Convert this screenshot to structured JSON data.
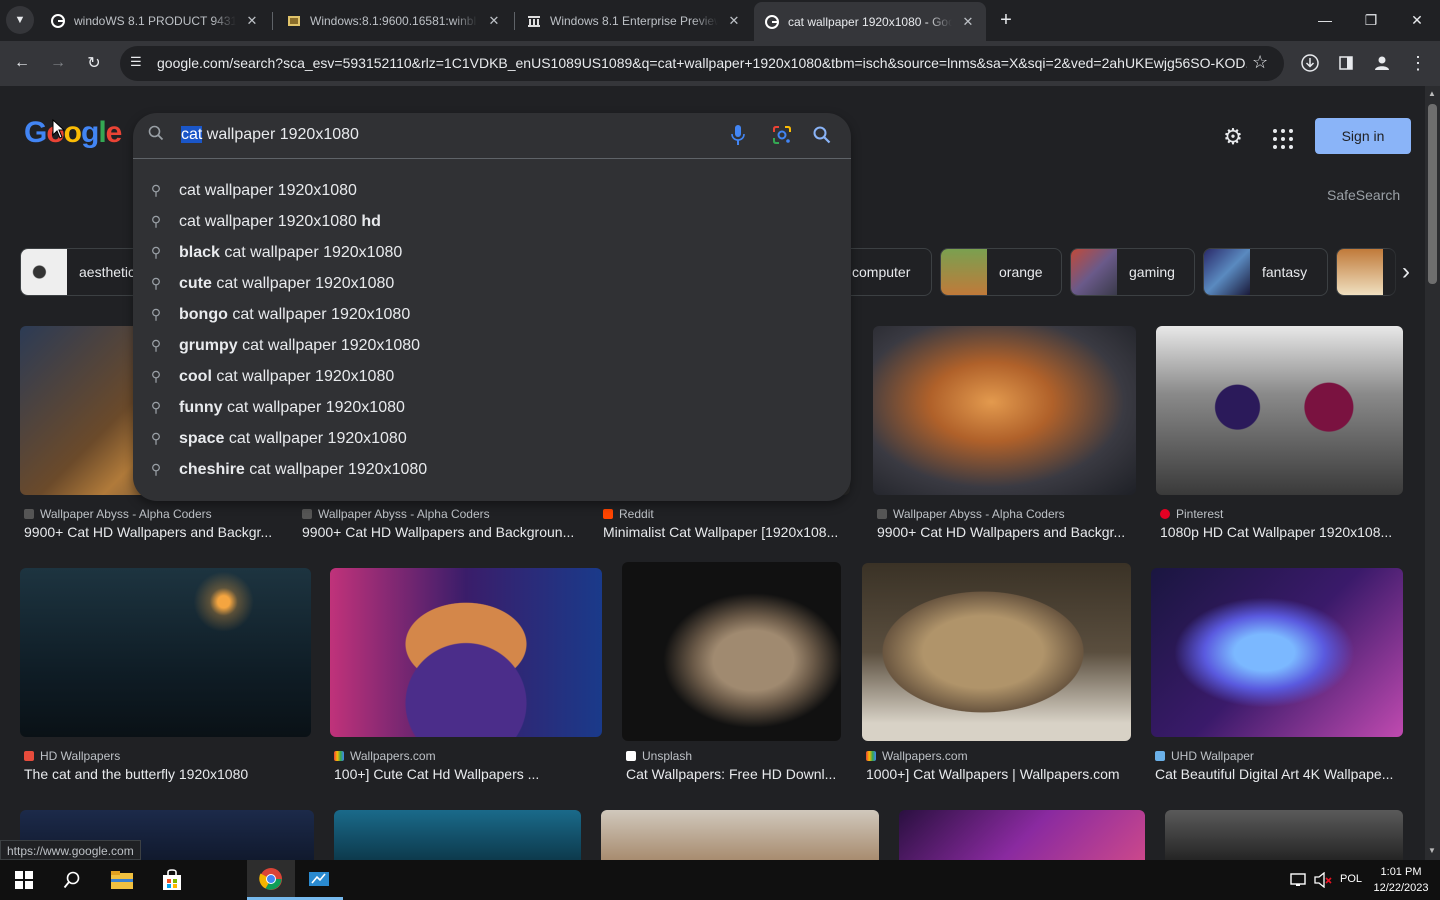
{
  "browser": {
    "tabs": [
      {
        "title": "windoWS 8.1 PRODUCT 9431 -",
        "favicon": "google-icon"
      },
      {
        "title": "Windows:8.1:9600.16581:winbl",
        "favicon": "page-icon"
      },
      {
        "title": "Windows 8.1 Enterprise Preview",
        "favicon": "archive-icon"
      },
      {
        "title": "cat wallpaper 1920x1080 - Goo",
        "favicon": "google-icon",
        "active": true
      }
    ],
    "new_tab": "+",
    "url": "google.com/search?sca_esv=593152110&rlz=1C1VDKB_enUS1089US1089&q=cat+wallpaper+1920x1080&tbm=isch&source=lnms&sa=X&sqi=2&ved=2ahUKEwjg56SO-KOD..."
  },
  "google": {
    "logo": "Google",
    "query_selected": "cat",
    "query_rest": " wallpaper 1920x1080",
    "suggestions": [
      {
        "bold": "",
        "text": "cat wallpaper 1920x1080",
        "tail_bold": ""
      },
      {
        "bold": "",
        "text": "cat wallpaper 1920x1080 ",
        "tail_bold": "hd"
      },
      {
        "bold": "black",
        "text": " cat wallpaper 1920x1080",
        "tail_bold": ""
      },
      {
        "bold": "cute",
        "text": " cat wallpaper 1920x1080",
        "tail_bold": ""
      },
      {
        "bold": "bongo",
        "text": " cat wallpaper 1920x1080",
        "tail_bold": ""
      },
      {
        "bold": "grumpy",
        "text": " cat wallpaper 1920x1080",
        "tail_bold": ""
      },
      {
        "bold": "cool",
        "text": " cat wallpaper 1920x1080",
        "tail_bold": ""
      },
      {
        "bold": "funny",
        "text": " cat wallpaper 1920x1080",
        "tail_bold": ""
      },
      {
        "bold": "space",
        "text": " cat wallpaper 1920x1080",
        "tail_bold": ""
      },
      {
        "bold": "cheshire",
        "text": " cat wallpaper 1920x1080",
        "tail_bold": ""
      }
    ],
    "sign_in": "Sign in",
    "safesearch": "SafeSearch",
    "chips": [
      "aesthetic",
      "computer",
      "orange",
      "gaming",
      "fantasy",
      ""
    ],
    "results": [
      {
        "source": "Wallpaper Abyss - Alpha Coders",
        "caption": "9900+ Cat HD Wallpapers and Backgr..."
      },
      {
        "source": "Wallpaper Abyss - Alpha Coders",
        "caption": "9900+ Cat HD Wallpapers and Backgroun..."
      },
      {
        "source": "Reddit",
        "caption": "Minimalist Cat Wallpaper [1920x108..."
      },
      {
        "source": "Wallpaper Abyss - Alpha Coders",
        "caption": "9900+ Cat HD Wallpapers and Backgr..."
      },
      {
        "source": "Pinterest",
        "caption": "1080p HD Cat Wallpaper 1920x108..."
      },
      {
        "source": "HD Wallpapers",
        "caption": "The cat and the butterfly 1920x1080"
      },
      {
        "source": "Wallpapers.com",
        "caption": "100+] Cute Cat Hd Wallpapers ..."
      },
      {
        "source": "Unsplash",
        "caption": "Cat Wallpapers: Free HD Downl..."
      },
      {
        "source": "Wallpapers.com",
        "caption": "1000+] Cat Wallpapers | Wallpapers.com"
      },
      {
        "source": "UHD Wallpaper",
        "caption": "Cat Beautiful Digital Art 4K Wallpape..."
      }
    ],
    "status_link": "https://www.google.com"
  },
  "taskbar": {
    "lang": "POL",
    "time": "1:01 PM",
    "date": "12/22/2023"
  },
  "colors": {
    "accent": "#8ab4f8",
    "selection": "#1a56c8"
  }
}
